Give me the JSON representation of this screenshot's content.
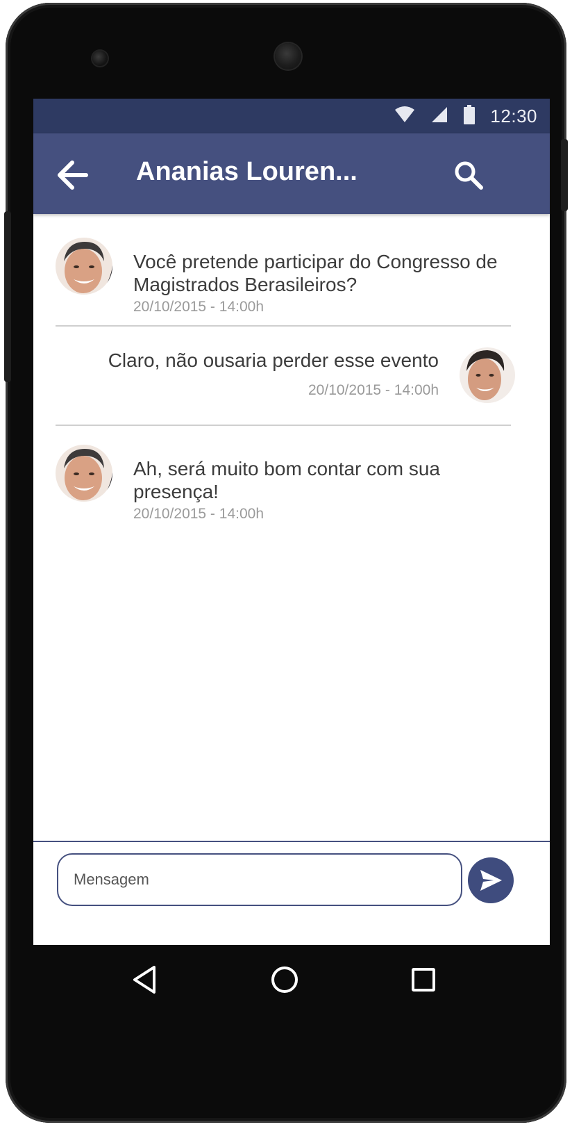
{
  "status_bar": {
    "time": "12:30",
    "icons": [
      "wifi-icon",
      "signal-icon",
      "battery-icon"
    ]
  },
  "app_bar": {
    "title": "Ananias Louren...",
    "back_icon": "arrow-left-icon",
    "search_icon": "search-icon"
  },
  "messages": [
    {
      "side": "left",
      "text": "Você pretende participar do Congresso de Magistrados Berasileiros?",
      "timestamp": "20/10/2015 - 14:00h"
    },
    {
      "side": "right",
      "text": "Claro, não ousaria perder esse evento",
      "timestamp": "20/10/2015 - 14:00h"
    },
    {
      "side": "left",
      "text": "Ah, será muito bom contar com sua presença!",
      "timestamp": "20/10/2015 - 14:00h"
    }
  ],
  "composer": {
    "placeholder": "Mensagem",
    "value": "",
    "send_icon": "send-icon"
  },
  "nav_bar": {
    "icons": [
      "back-triangle-icon",
      "home-circle-icon",
      "recents-square-icon"
    ]
  },
  "colors": {
    "status_bar": "#2e3a62",
    "app_bar": "#45507f",
    "accent": "#3f4c7e",
    "text": "#3c3c3c",
    "timestamp": "#9a9a9a"
  }
}
